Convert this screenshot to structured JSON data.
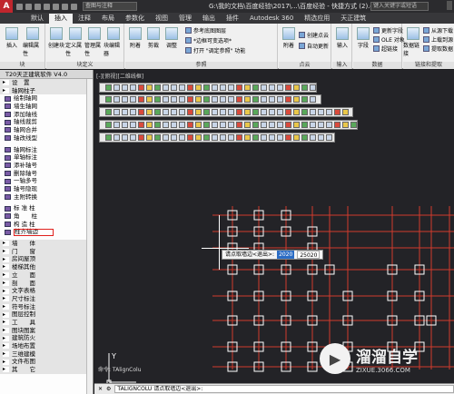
{
  "title_bar": {
    "app_logo": "A",
    "search_placeholder": "查图与注释",
    "document_title": "G:\\我的文档\\百度经验\\2017\\...\\百度经验 - 快捷方式 (2).dwg",
    "right_search_placeholder": "键入关键字或短语"
  },
  "ribbon_tabs": [
    "默认",
    "插入",
    "注释",
    "布局",
    "参数化",
    "视图",
    "管理",
    "输出",
    "插件",
    "Autodesk 360",
    "精选应用",
    "天正建筑"
  ],
  "active_tab_index": 1,
  "ribbon": {
    "groups": [
      {
        "label": "块",
        "buttons": [
          "插入",
          "编辑属性"
        ]
      },
      {
        "label": "块定义",
        "buttons": [
          "创建块",
          "定义属性",
          "管理属性",
          "块编辑器"
        ]
      },
      {
        "label": "参照",
        "buttons": [
          "附着",
          "剪裁",
          "调整"
        ],
        "small": [
          "参考底图图层",
          "*边框可变选项*",
          "打开 \"调定参照\" 功能"
        ]
      },
      {
        "label": "点云",
        "buttons": [
          "附着",
          "创建点云"
        ],
        "small": [
          "自动更新"
        ]
      },
      {
        "label": "输入",
        "buttons": [
          "输入"
        ]
      },
      {
        "label": "数据",
        "buttons": [
          "字段"
        ],
        "small": [
          "更新字段",
          "OLE 对象",
          "超链接"
        ]
      },
      {
        "label": "链接和提取",
        "buttons": [
          "数据链接"
        ],
        "small": [
          "从源下载",
          "上载到源",
          "提取数据"
        ]
      }
    ]
  },
  "left_panel": {
    "title": "T20天正建筑软件 V4.0",
    "items": [
      {
        "label": "设　置",
        "section": true
      },
      {
        "label": "轴网柱子",
        "section": true
      },
      {
        "label": "绘制轴网"
      },
      {
        "label": "墙生轴网"
      },
      {
        "label": "添加轴线"
      },
      {
        "label": "轴线裁剪"
      },
      {
        "label": "轴网合并"
      },
      {
        "label": "轴改线型"
      },
      {
        "label": "",
        "sep": true
      },
      {
        "label": "轴网标注"
      },
      {
        "label": "单轴标注"
      },
      {
        "label": "添补轴号"
      },
      {
        "label": "删除轴号"
      },
      {
        "label": "一轴多号"
      },
      {
        "label": "轴号隐现"
      },
      {
        "label": "主附转换"
      },
      {
        "label": "",
        "sep": true
      },
      {
        "label": "标 准 柱"
      },
      {
        "label": "角　　柱"
      },
      {
        "label": "构 造 柱"
      },
      {
        "label": "柱齐墙边",
        "highlight": true
      },
      {
        "label": "",
        "sep": true
      },
      {
        "label": "墙　　体",
        "section": true
      },
      {
        "label": "门　　窗",
        "section": true
      },
      {
        "label": "房间屋顶",
        "section": true
      },
      {
        "label": "楼梯其他",
        "section": true
      },
      {
        "label": "立　　面",
        "section": true
      },
      {
        "label": "剖　　面",
        "section": true
      },
      {
        "label": "文字表格",
        "section": true
      },
      {
        "label": "尺寸标注",
        "section": true
      },
      {
        "label": "符号标注",
        "section": true
      },
      {
        "label": "图层控制",
        "section": true
      },
      {
        "label": "工　　具",
        "section": true
      },
      {
        "label": "图块图案",
        "section": true
      },
      {
        "label": "建筑防火",
        "section": true
      },
      {
        "label": "场地布置",
        "section": true
      },
      {
        "label": "三维建模",
        "section": true
      },
      {
        "label": "文件布图",
        "section": true
      },
      {
        "label": "其　　它",
        "section": true
      }
    ]
  },
  "drawing": {
    "view_label": "[-][俯视][二维线框]",
    "prompt": "请点取墙边<退出>:",
    "prompt_selected": "2020",
    "prompt_value": "25020",
    "command_history": "命令: TAlignColu",
    "command_input": "TALIGNCOLU 请点取墙边<退出>:",
    "axis_y": "Y",
    "axis_x": "X",
    "layout_tabs": [
      "模型",
      "布局1",
      "布局2"
    ]
  },
  "watermark": {
    "brand": "溜溜自学",
    "url": "ZIXUE.3066.COM"
  }
}
